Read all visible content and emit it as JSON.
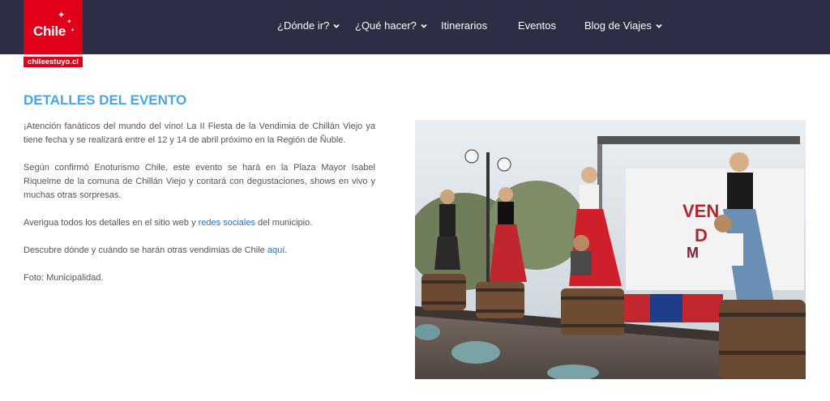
{
  "brand": {
    "logo_text": "Chile",
    "site": "chileestuyo.cl",
    "color": "#e1001a",
    "nav_bg": "#2b2e45"
  },
  "nav": {
    "items": [
      {
        "label": "¿Dónde ir?",
        "dropdown": true
      },
      {
        "label": "¿Qué hacer?",
        "dropdown": true
      },
      {
        "label": "Itinerarios",
        "dropdown": false
      },
      {
        "label": "Eventos",
        "dropdown": false
      },
      {
        "label": "Blog de Viajes",
        "dropdown": true
      }
    ]
  },
  "event": {
    "title": "DETALLES DEL EVENTO",
    "p1": "¡Atención fanáticos del mundo del vino! La II Fiesta de la Vendimia de Chillán Viejo ya tiene fecha y se realizará entre el 12 y 14 de abril próximo en la Región de Ñuble.",
    "p2": "Según confirmó Enoturismo Chile, este evento se hará en la Plaza Mayor Isabel Riquelme de la comuna de Chillán Viejo y contará con degustaciones, shows en vivo y muchas otras sorpresas.",
    "p3_before": "Averigua todos los detalles en el sitio web y ",
    "p3_link": "redes sociales",
    "p3_after": " del municipio.",
    "p4_before": "Descubre dónde y cuándo se harán otras vendimias de Chile ",
    "p4_link": "aquí",
    "p4_after": ".",
    "p5": "Foto: Municipalidad.",
    "title_color": "#4aa5e6",
    "link_color": "#1a73c8"
  }
}
